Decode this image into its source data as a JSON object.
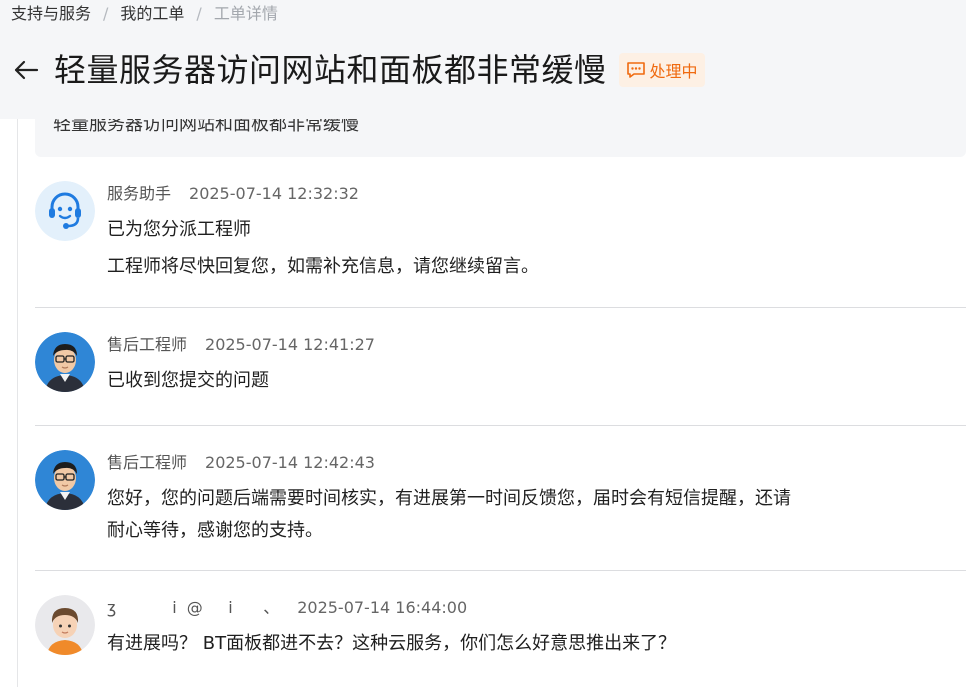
{
  "breadcrumb": {
    "items": [
      "支持与服务",
      "我的工单",
      "工单详情"
    ],
    "separator": "/"
  },
  "ticket": {
    "title": "轻量服务器访问网站和面板都非常缓慢",
    "status": "处理中",
    "status_color": "#f06a0f",
    "description": "轻量服务器访问网站和面板都非常缓慢"
  },
  "messages": [
    {
      "author": "服务助手",
      "time": "2025-07-14 12:32:32",
      "avatar_icon": "robot-assistant-icon",
      "lines": [
        "已为您分派工程师",
        "工程师将尽快回复您，如需补充信息，请您继续留言。"
      ]
    },
    {
      "author": "售后工程师",
      "time": "2025-07-14 12:41:27",
      "avatar_icon": "engineer-avatar",
      "lines": [
        "已收到您提交的问题"
      ]
    },
    {
      "author": "售后工程师",
      "time": "2025-07-14 12:42:43",
      "avatar_icon": "engineer-avatar",
      "lines": [
        "您好，您的问题后端需要时间核实，有进展第一时间反馈您，届时会有短信提醒，还请",
        "耐心等待，感谢您的支持。"
      ]
    },
    {
      "author": "ʒ           i  @     i      、",
      "time": "2025-07-14 16:44:00",
      "avatar_icon": "user-avatar",
      "lines": [
        "有进展吗？ BT面板都进不去？这种云服务，你们怎么好意思推出来了？"
      ]
    }
  ]
}
